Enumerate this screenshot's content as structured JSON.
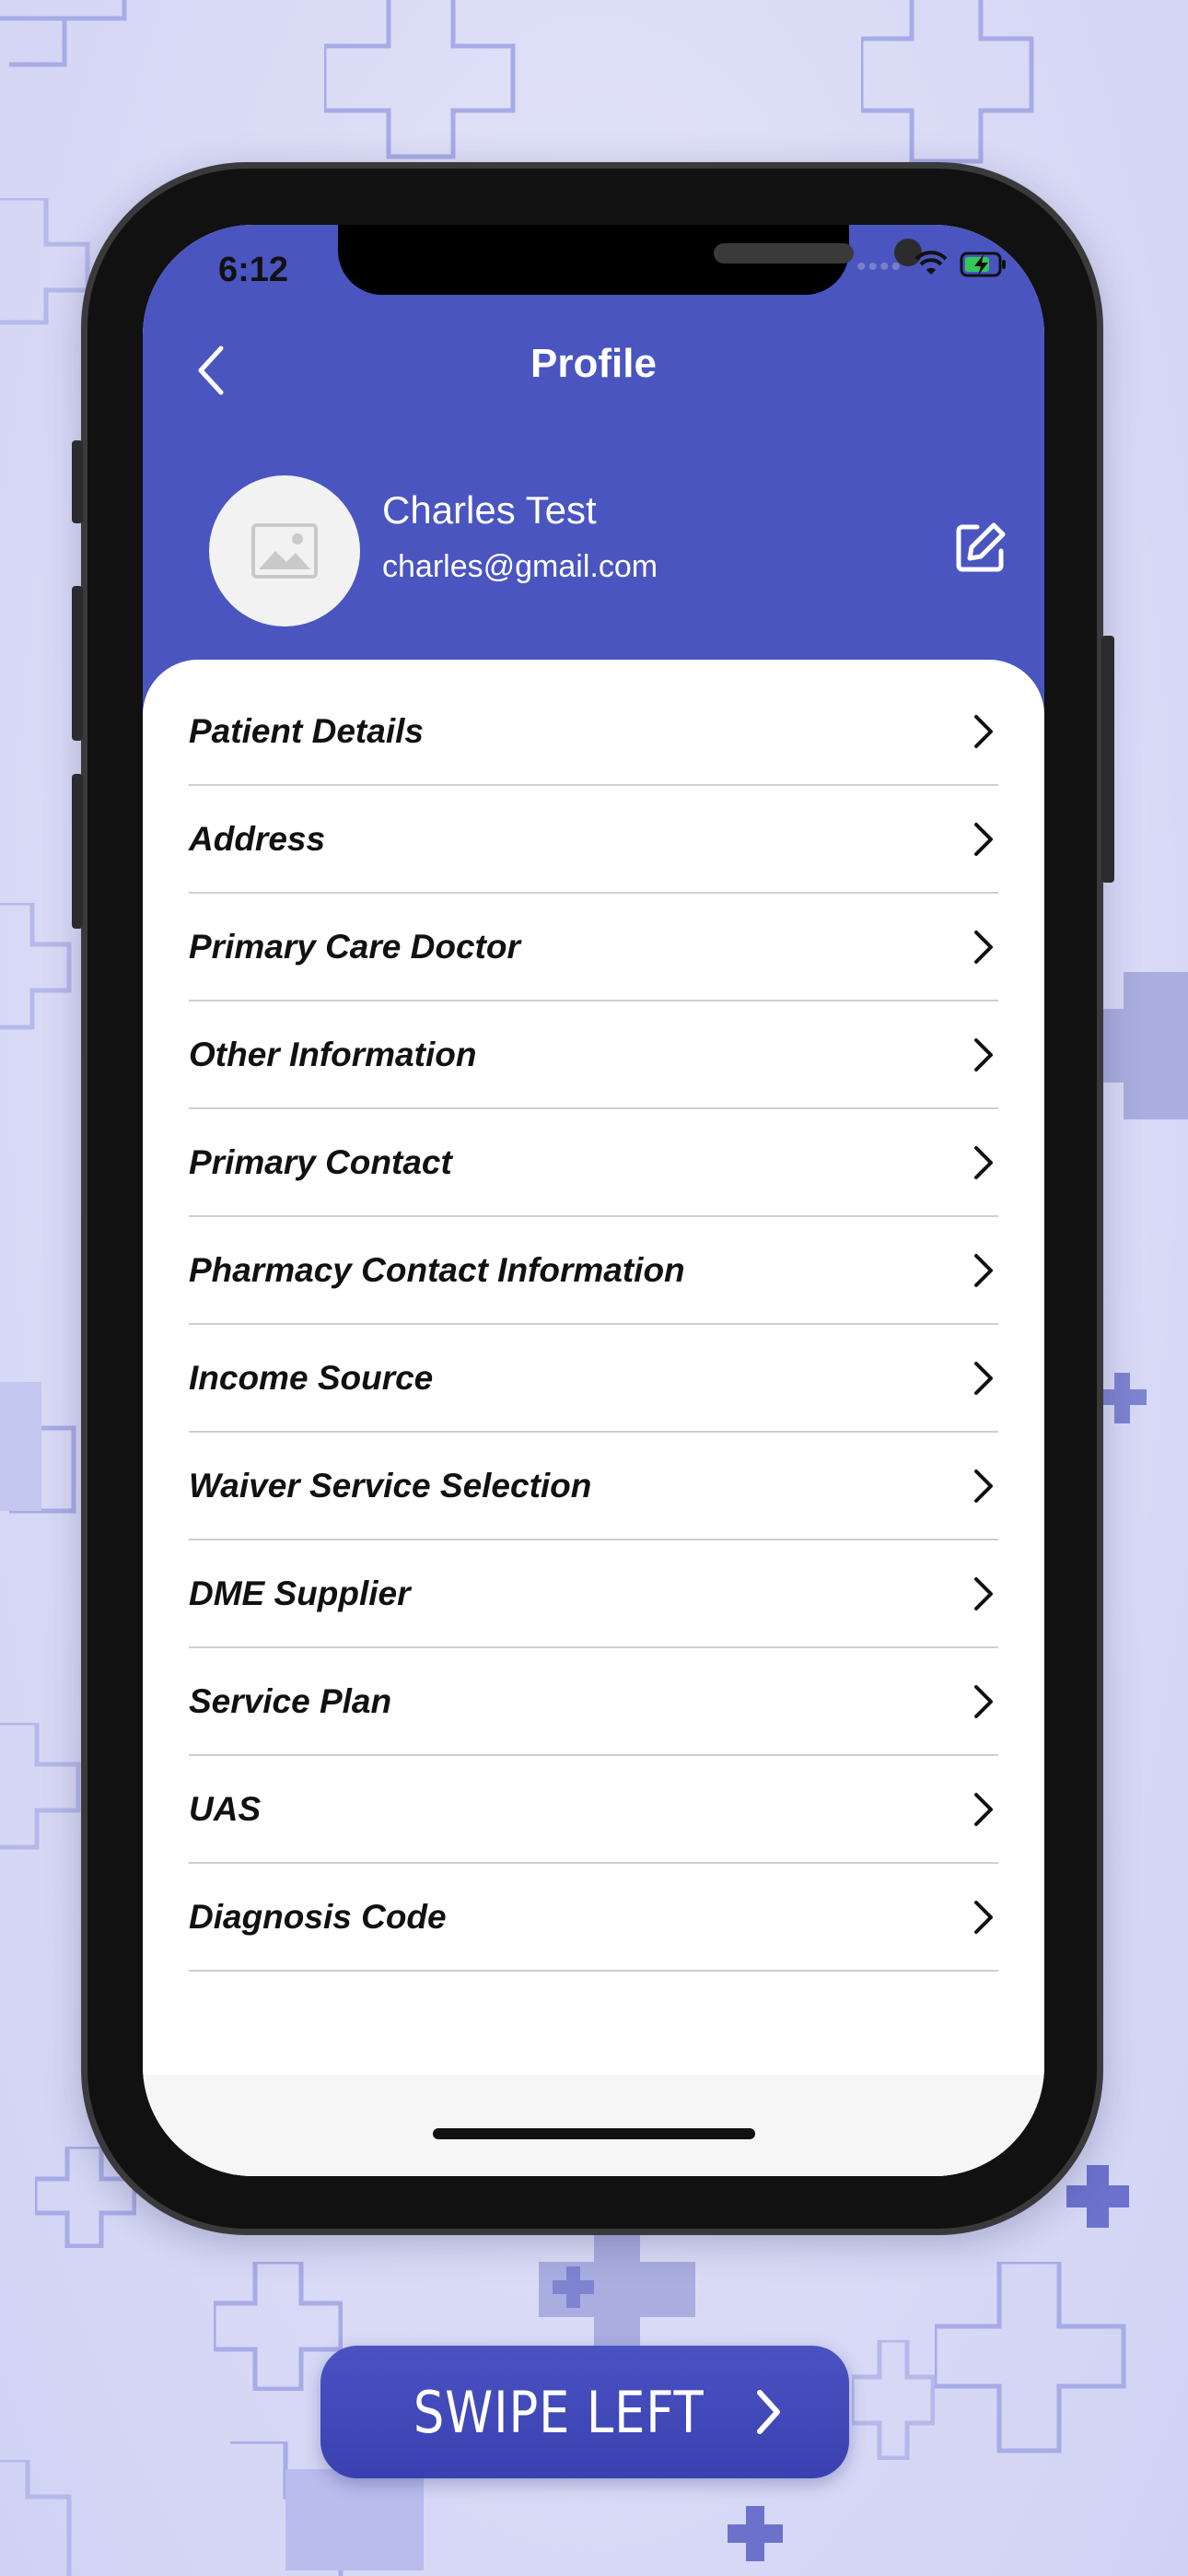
{
  "status_bar": {
    "time": "6:12"
  },
  "header": {
    "title": "Profile"
  },
  "user": {
    "name": "Charles Test",
    "email": "charles@gmail.com"
  },
  "menu_items": [
    {
      "label": "Patient Details"
    },
    {
      "label": "Address"
    },
    {
      "label": "Primary Care Doctor"
    },
    {
      "label": "Other Information"
    },
    {
      "label": "Primary Contact"
    },
    {
      "label": "Pharmacy Contact Information"
    },
    {
      "label": "Income Source"
    },
    {
      "label": "Waiver Service Selection"
    },
    {
      "label": "DME Supplier"
    },
    {
      "label": "Service Plan"
    },
    {
      "label": "UAS"
    },
    {
      "label": "Diagnosis Code"
    }
  ],
  "swipe": {
    "label": "SWIPE LEFT"
  },
  "colors": {
    "brand": "#4a55c0",
    "background": "#dcdef7",
    "battery": "#34c759"
  },
  "icons": [
    "back-chevron-icon",
    "image-placeholder-icon",
    "edit-icon",
    "chevron-right-icon",
    "wifi-icon",
    "battery-charging-icon"
  ]
}
